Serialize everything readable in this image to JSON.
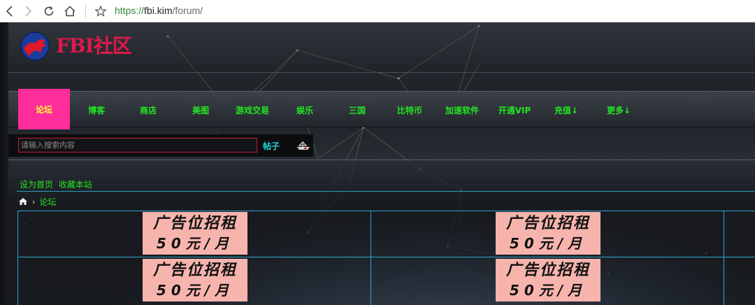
{
  "browser": {
    "url_protocol": "https://",
    "url_host": "fbi.kim",
    "url_path": "/forum/"
  },
  "header": {
    "site_name": "FBI社区"
  },
  "nav": {
    "items": [
      {
        "label": "论坛",
        "active": true
      },
      {
        "label": "博客"
      },
      {
        "label": "商店"
      },
      {
        "label": "美图"
      },
      {
        "label": "游戏交易"
      },
      {
        "label": "娱乐"
      },
      {
        "label": "三国"
      },
      {
        "label": "比特币"
      },
      {
        "label": "加速软件"
      },
      {
        "label": "开通VIP"
      },
      {
        "label": "充值↓"
      },
      {
        "label": "更多↓"
      }
    ]
  },
  "search": {
    "placeholder": "请输入搜索内容",
    "type_label": "帖子"
  },
  "quick_links": {
    "set_home": "设为首页",
    "bookmark": "收藏本站"
  },
  "breadcrumb": {
    "current": "论坛"
  },
  "ads": {
    "line1": "广告位招租",
    "line2": "50元/月"
  },
  "colors": {
    "nav_text": "#22e622",
    "nav_active_bg": "#ff2d9a",
    "nav_active_text": "#ffff33",
    "brand": "#e0184a",
    "table_border": "#2fa8cc",
    "ad_bg": "#f6b4ad"
  }
}
